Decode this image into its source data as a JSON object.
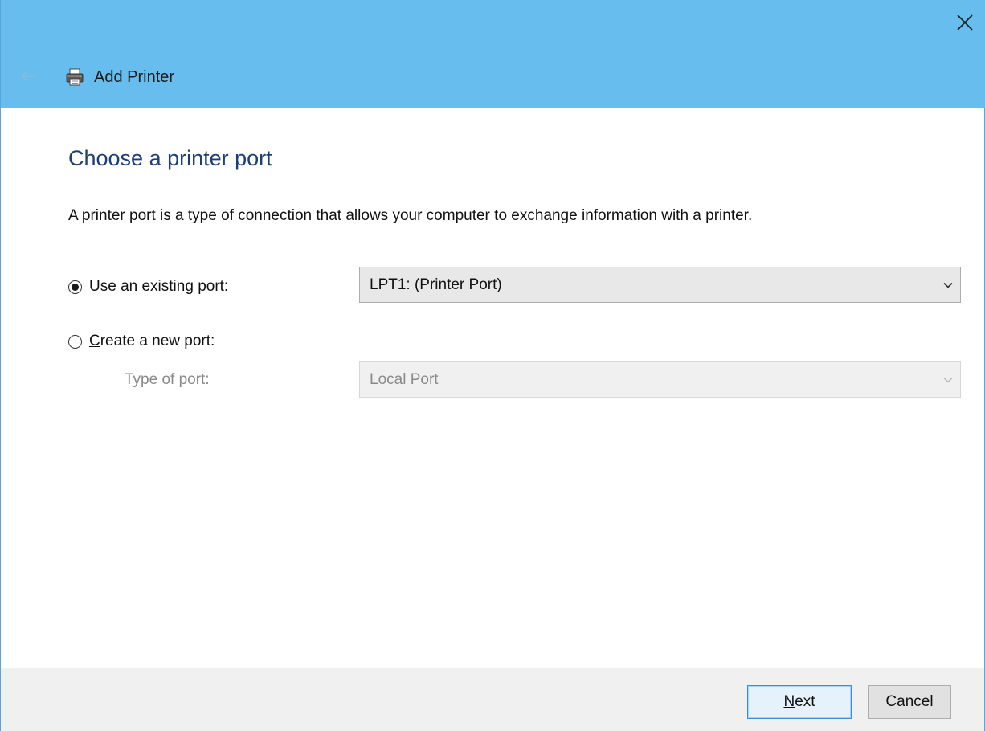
{
  "window": {
    "title": "Add Printer",
    "titlebar_color": "#66bdee",
    "icons": {
      "close": "close-icon",
      "back": "back-arrow-icon",
      "app": "printer-icon"
    }
  },
  "page": {
    "heading": "Choose a printer port",
    "description": "A printer port is a type of connection that allows your computer to exchange information with a printer.",
    "heading_color": "#1c3f77"
  },
  "options": {
    "existing": {
      "label_accel": "U",
      "label_rest": "se an existing port:",
      "selected": true,
      "value": "LPT1: (Printer Port)"
    },
    "new": {
      "label_accel": "C",
      "label_rest": "reate a new port:",
      "selected": false,
      "type_label": "Type of port:",
      "type_value": "Local Port",
      "type_disabled": true
    }
  },
  "footer": {
    "next_accel": "N",
    "next_rest": "ext",
    "cancel_label": "Cancel"
  }
}
